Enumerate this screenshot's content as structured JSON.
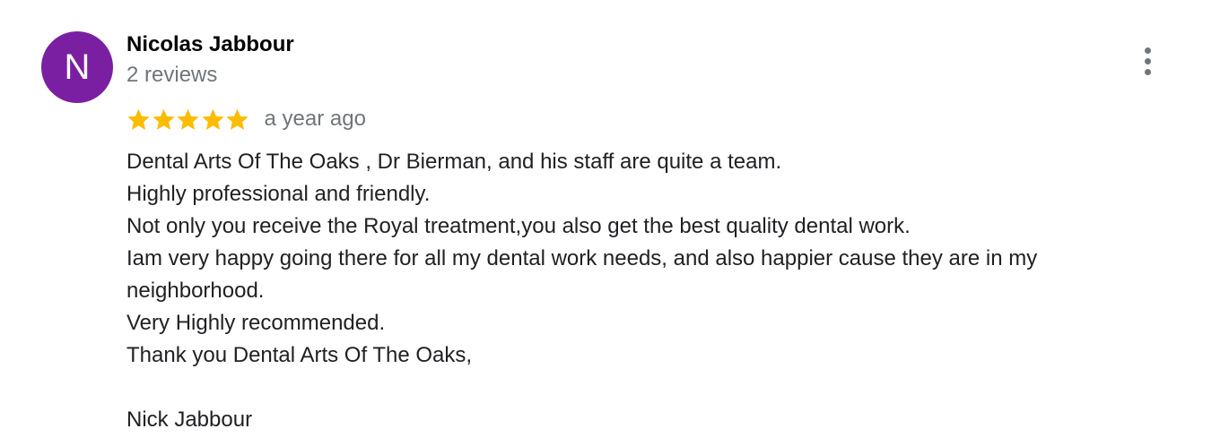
{
  "review": {
    "avatar_initial": "N",
    "avatar_color": "#7b1fa2",
    "reviewer_name": "Nicolas Jabbour",
    "review_count": "2 reviews",
    "rating": 5,
    "rating_max": 5,
    "star_color": "#fbbc04",
    "time_ago": "a year ago",
    "more_options_icon": "more-vert-icon",
    "text_lines": [
      "Dental Arts Of The Oaks , Dr Bierman, and his staff are quite a team.",
      "Highly professional and friendly.",
      "Not only you receive the Royal treatment,you also get the best quality dental work.",
      "Iam very happy going there for all my dental work needs, and also happier cause they are in my neighborhood.",
      "Very Highly recommended.",
      "Thank you Dental Arts Of The Oaks,",
      "",
      "Nick Jabbour"
    ]
  }
}
